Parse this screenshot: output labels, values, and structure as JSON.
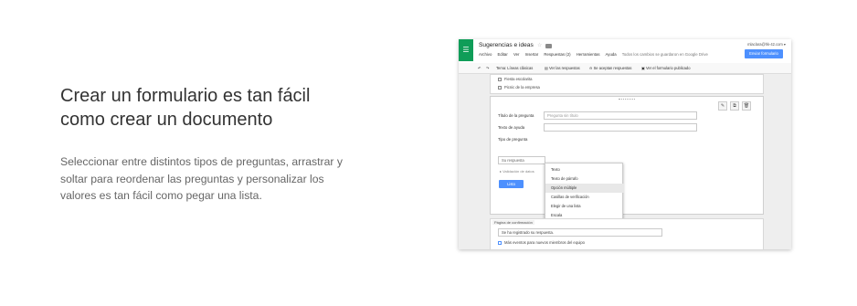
{
  "marketing": {
    "headline_line1": "Crear un formulario es tan fácil",
    "headline_line2": "como crear un documento",
    "description": "Seleccionar entre distintos tipos de preguntas, arrastrar y soltar para reordenar las preguntas y personalizar los valores es tan fácil como pegar una lista."
  },
  "app": {
    "title": "Sugerencias e ideas",
    "account": "mlaclara@hk-42.com ▾",
    "send_label": "Enviar formulario",
    "menu": [
      "Archivo",
      "Editar",
      "Ver",
      "Insertar",
      "Respuestas (2)",
      "Herramientas",
      "Ayuda"
    ],
    "save_note": "Todos los cambios se guardaron en Google Drive",
    "toolbar": {
      "theme": "Tema: Líneas clásicas",
      "view_responses": "Ver las respuestas",
      "accepting": "Se aceptan respuestas",
      "view_published": "Ver el formulario publicado"
    }
  },
  "form": {
    "options_above": [
      "Fiesta escolarita",
      "Picnic de la empresa"
    ],
    "question_title_label": "Título de la pregunta",
    "question_title_placeholder": "Pregunta sin título",
    "help_text_label": "Texto de ayuda",
    "question_type_label": "Tipo de pregunta",
    "answer_preview": "Su respuesta",
    "advanced_label": "▸ Validación de datos",
    "done_label": "Listo",
    "question_types": [
      "Texto",
      "Texto de párrafo",
      "Opción múltiple",
      "Casillas de verificación",
      "Elegir de una lista",
      "Escala",
      "Cuadrícula",
      "Fecha",
      "Hora"
    ],
    "selected_type_index": 2,
    "add_item_label": "Agregar elemento",
    "confirmation_header": "Página de confirmación",
    "confirmation_text": "Se ha registrado su respuesta.",
    "confirmation_option": "Más eventos para nuevos miembros del equipo"
  }
}
